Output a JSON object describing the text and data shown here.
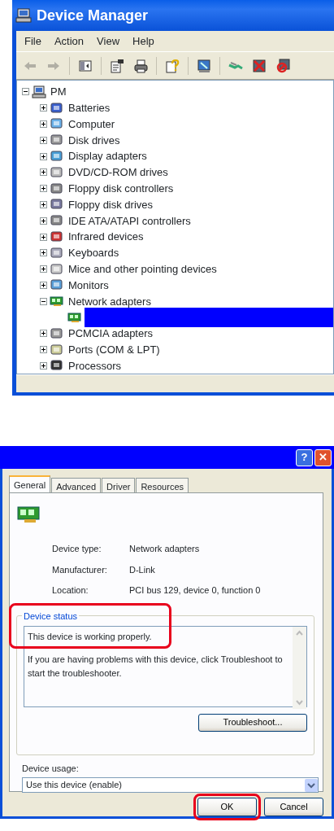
{
  "main_window": {
    "title": "Device Manager",
    "menu": [
      "File",
      "Action",
      "View",
      "Help"
    ],
    "toolbar": [
      {
        "kind": "back",
        "disabled": true
      },
      {
        "kind": "forward",
        "disabled": true
      },
      {
        "kind": "pane",
        "disabled": false
      },
      {
        "kind": "properties",
        "disabled": false
      },
      {
        "kind": "print",
        "disabled": false
      },
      {
        "kind": "help",
        "disabled": false
      },
      {
        "kind": "scan",
        "disabled": false
      },
      {
        "kind": "update",
        "disabled": false
      },
      {
        "kind": "uninstall",
        "disabled": false
      },
      {
        "kind": "disable",
        "disabled": false
      }
    ],
    "tree": {
      "label": "PM",
      "expanded": true,
      "selected": false,
      "children": [
        {
          "label": "Batteries",
          "expanded": false,
          "selected": false
        },
        {
          "label": "Computer",
          "expanded": false,
          "selected": false
        },
        {
          "label": "Disk drives",
          "expanded": false,
          "selected": false
        },
        {
          "label": "Display adapters",
          "expanded": false,
          "selected": false
        },
        {
          "label": "DVD/CD-ROM drives",
          "expanded": false,
          "selected": false
        },
        {
          "label": "Floppy disk controllers",
          "expanded": false,
          "selected": false
        },
        {
          "label": "Floppy disk drives",
          "expanded": false,
          "selected": false
        },
        {
          "label": "IDE ATA/ATAPI controllers",
          "expanded": false,
          "selected": false
        },
        {
          "label": "Infrared devices",
          "expanded": false,
          "selected": false
        },
        {
          "label": "Keyboards",
          "expanded": false,
          "selected": false
        },
        {
          "label": "Mice and other pointing devices",
          "expanded": false,
          "selected": false
        },
        {
          "label": "Monitors",
          "expanded": false,
          "selected": false
        },
        {
          "label": "Network adapters",
          "expanded": true,
          "selected": false,
          "children": [
            {
              "selected": true
            }
          ]
        },
        {
          "label": "PCMCIA adapters",
          "expanded": false,
          "selected": false
        },
        {
          "label": "Ports (COM & LPT)",
          "expanded": false,
          "selected": false
        },
        {
          "label": "Processors",
          "expanded": false,
          "selected": false
        }
      ]
    }
  },
  "dialog": {
    "title_buttons": [
      {
        "kind": "help",
        "label": "?"
      },
      {
        "kind": "close",
        "label": "✕"
      }
    ],
    "tabs": [
      {
        "label": "General",
        "selected": true
      },
      {
        "label": "Advanced",
        "selected": false
      },
      {
        "label": "Driver",
        "selected": false
      },
      {
        "label": "Resources",
        "selected": false
      }
    ],
    "properties": [
      {
        "label": "Device type:",
        "value": "Network adapters"
      },
      {
        "label": "Manufacturer:",
        "value": "D-Link"
      },
      {
        "label": "Location:",
        "value": "PCI bus 129, device 0, function 0"
      }
    ],
    "device_status": {
      "legend": "Device status",
      "annotated": true,
      "lines": [
        "This device is working properly.",
        "If you are having problems with this device, click Troubleshoot to start the troubleshooter."
      ]
    },
    "troubleshoot_button": "Troubleshoot...",
    "device_usage": {
      "label": "Device usage:",
      "value": "Use this device (enable)"
    },
    "buttons": [
      {
        "label": "OK",
        "annotated": true
      },
      {
        "label": "Cancel",
        "annotated": false
      }
    ]
  }
}
